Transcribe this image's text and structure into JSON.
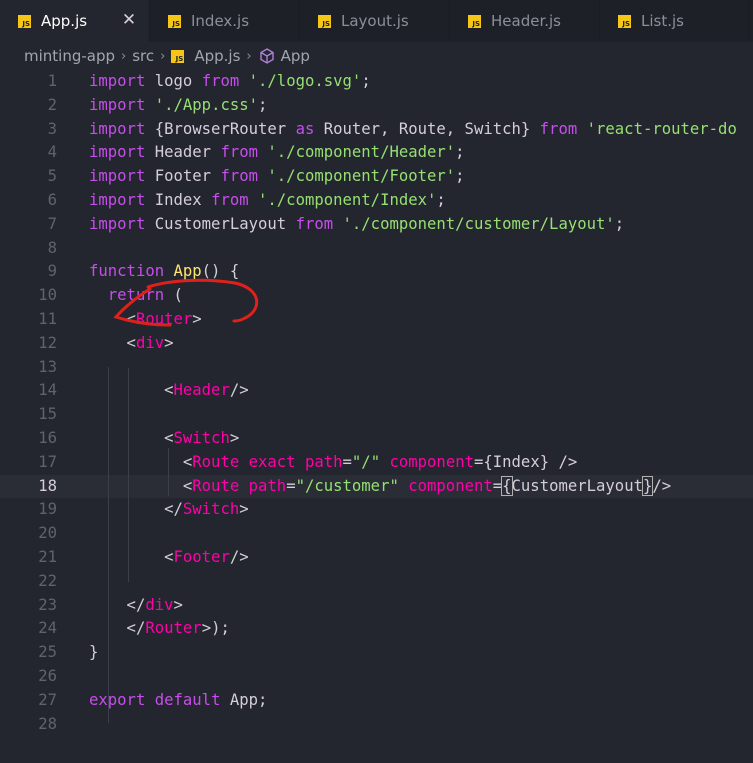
{
  "tabs": [
    {
      "label": "App.js",
      "icon": "js-file-icon",
      "active": true
    },
    {
      "label": "Index.js",
      "icon": "js-file-icon",
      "active": false
    },
    {
      "label": "Layout.js",
      "icon": "js-file-icon",
      "active": false
    },
    {
      "label": "Header.js",
      "icon": "js-file-icon",
      "active": false
    },
    {
      "label": "List.js",
      "icon": "js-file-icon",
      "active": false
    }
  ],
  "tab_close_glyph": "✕",
  "js_badge": "JS",
  "breadcrumb": {
    "folder": "minting-app",
    "subfolder": "src",
    "file": "App.js",
    "symbol": "App",
    "separator": "›"
  },
  "editor": {
    "current_line": 18,
    "lines": [
      {
        "n": "1",
        "tokens": [
          [
            "kw",
            "import"
          ],
          [
            "id",
            " logo "
          ],
          [
            "kw",
            "from"
          ],
          [
            "id",
            " "
          ],
          [
            "str",
            "'./logo.svg'"
          ],
          [
            "id",
            ";"
          ]
        ]
      },
      {
        "n": "2",
        "tokens": [
          [
            "kw",
            "import"
          ],
          [
            "id",
            " "
          ],
          [
            "str",
            "'./App.css'"
          ],
          [
            "id",
            ";"
          ]
        ]
      },
      {
        "n": "3",
        "tokens": [
          [
            "kw",
            "import"
          ],
          [
            "id",
            " {BrowserRouter "
          ],
          [
            "kw",
            "as"
          ],
          [
            "id",
            " Router, Route, Switch} "
          ],
          [
            "kw",
            "from"
          ],
          [
            "id",
            " "
          ],
          [
            "str",
            "'react-router-do"
          ]
        ]
      },
      {
        "n": "4",
        "tokens": [
          [
            "kw",
            "import"
          ],
          [
            "id",
            " Header "
          ],
          [
            "kw",
            "from"
          ],
          [
            "id",
            " "
          ],
          [
            "str",
            "'./component/Header'"
          ],
          [
            "id",
            ";"
          ]
        ]
      },
      {
        "n": "5",
        "tokens": [
          [
            "kw",
            "import"
          ],
          [
            "id",
            " Footer "
          ],
          [
            "kw",
            "from"
          ],
          [
            "id",
            " "
          ],
          [
            "str",
            "'./component/Footer'"
          ],
          [
            "id",
            ";"
          ]
        ]
      },
      {
        "n": "6",
        "tokens": [
          [
            "kw",
            "import"
          ],
          [
            "id",
            " Index "
          ],
          [
            "kw",
            "from"
          ],
          [
            "id",
            " "
          ],
          [
            "str",
            "'./component/Index'"
          ],
          [
            "id",
            ";"
          ]
        ]
      },
      {
        "n": "7",
        "tokens": [
          [
            "kw",
            "import"
          ],
          [
            "id",
            " CustomerLayout "
          ],
          [
            "kw",
            "from"
          ],
          [
            "id",
            " "
          ],
          [
            "str",
            "'./component/customer/Layout'"
          ],
          [
            "id",
            ";"
          ]
        ]
      },
      {
        "n": "8",
        "tokens": []
      },
      {
        "n": "9",
        "tokens": [
          [
            "kw",
            "function"
          ],
          [
            "id",
            " "
          ],
          [
            "fn",
            "App"
          ],
          [
            "id",
            "() {"
          ]
        ]
      },
      {
        "n": "10",
        "tokens": [
          [
            "id",
            "  "
          ],
          [
            "kw",
            "return"
          ],
          [
            "id",
            " ("
          ]
        ]
      },
      {
        "n": "11",
        "tokens": [
          [
            "id",
            "    <"
          ],
          [
            "tag",
            "Router"
          ],
          [
            "id",
            ">"
          ]
        ]
      },
      {
        "n": "12",
        "tokens": [
          [
            "id",
            "    <"
          ],
          [
            "tag",
            "div"
          ],
          [
            "id",
            ">"
          ]
        ]
      },
      {
        "n": "13",
        "tokens": []
      },
      {
        "n": "14",
        "tokens": [
          [
            "id",
            "        <"
          ],
          [
            "tag",
            "Header"
          ],
          [
            "id",
            "/>"
          ]
        ]
      },
      {
        "n": "15",
        "tokens": []
      },
      {
        "n": "16",
        "tokens": [
          [
            "id",
            "        <"
          ],
          [
            "tag",
            "Switch"
          ],
          [
            "id",
            ">"
          ]
        ]
      },
      {
        "n": "17",
        "tokens": [
          [
            "id",
            "          <"
          ],
          [
            "tag",
            "Route"
          ],
          [
            "id",
            " "
          ],
          [
            "attr",
            "exact"
          ],
          [
            "id",
            " "
          ],
          [
            "attr",
            "path"
          ],
          [
            "id",
            "="
          ],
          [
            "str",
            "\"/\""
          ],
          [
            "id",
            " "
          ],
          [
            "attr",
            "component"
          ],
          [
            "id",
            "={Index} />"
          ]
        ]
      },
      {
        "n": "18",
        "tokens": [
          [
            "id",
            "          <"
          ],
          [
            "tag",
            "Route"
          ],
          [
            "id",
            " "
          ],
          [
            "attr",
            "path"
          ],
          [
            "id",
            "="
          ],
          [
            "str",
            "\"/customer\""
          ],
          [
            "id",
            " "
          ],
          [
            "attr",
            "component"
          ],
          [
            "id",
            "="
          ],
          [
            "box",
            "{"
          ],
          [
            "id",
            "CustomerLayout"
          ],
          [
            "box",
            "}"
          ],
          [
            "id",
            "/>"
          ]
        ]
      },
      {
        "n": "19",
        "tokens": [
          [
            "id",
            "        </"
          ],
          [
            "tag",
            "Switch"
          ],
          [
            "id",
            ">"
          ]
        ]
      },
      {
        "n": "20",
        "tokens": []
      },
      {
        "n": "21",
        "tokens": [
          [
            "id",
            "        <"
          ],
          [
            "tag",
            "Footer"
          ],
          [
            "id",
            "/>"
          ]
        ]
      },
      {
        "n": "22",
        "tokens": []
      },
      {
        "n": "23",
        "tokens": [
          [
            "id",
            "    </"
          ],
          [
            "tag",
            "div"
          ],
          [
            "id",
            ">"
          ]
        ]
      },
      {
        "n": "24",
        "tokens": [
          [
            "id",
            "    </"
          ],
          [
            "tag",
            "Router"
          ],
          [
            "id",
            ">);"
          ]
        ]
      },
      {
        "n": "25",
        "tokens": [
          [
            "id",
            "}"
          ]
        ]
      },
      {
        "n": "26",
        "tokens": []
      },
      {
        "n": "27",
        "tokens": [
          [
            "kw",
            "export"
          ],
          [
            "id",
            " "
          ],
          [
            "kw",
            "default"
          ],
          [
            "id",
            " App;"
          ]
        ]
      },
      {
        "n": "28",
        "tokens": []
      }
    ]
  },
  "colors": {
    "keyword": "#c74ded",
    "string": "#96e072",
    "tag": "#ff00aa",
    "function": "#ffe66d",
    "text": "#d5ced9",
    "annotation": "#e0211b"
  }
}
